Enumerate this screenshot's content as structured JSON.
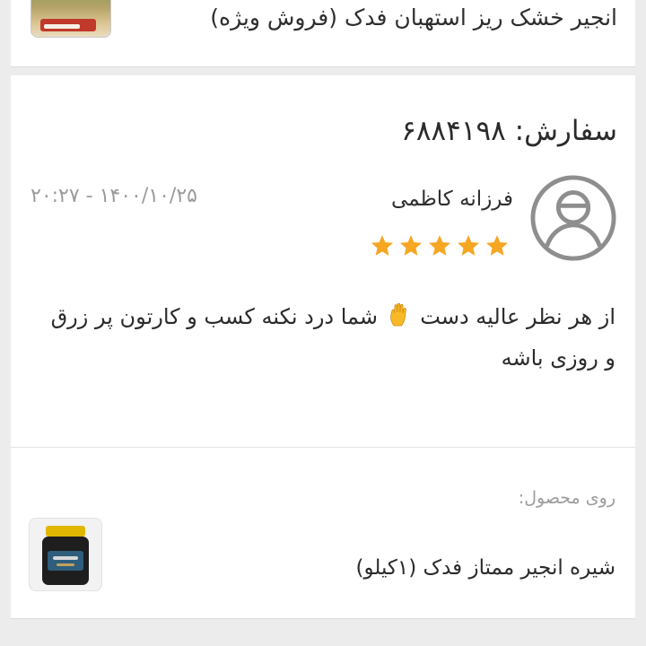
{
  "top_card": {
    "product_title": "انجیر خشک ریز استهبان فدک (فروش ویژه)"
  },
  "review": {
    "order_label": "سفارش: ۶۸۸۴۱۹۸",
    "author": "فرزانه کاظمی",
    "date": "۲۰:۲۷ - ۱۴۰۰/۱۰/۲۵",
    "rating": 5,
    "rating_max": 5,
    "star_color": "#f5a623",
    "comment_part1": "از هر نظر عالیه دست",
    "comment_emoji_icon": "raised-hand-icon",
    "comment_part2": "شما درد نکنه کسب و کارتون پر زرق و روزی باشه"
  },
  "product": {
    "on_product_label": "روی محصول:",
    "name": "شیره انجیر ممتاز فدک (۱کیلو)"
  }
}
